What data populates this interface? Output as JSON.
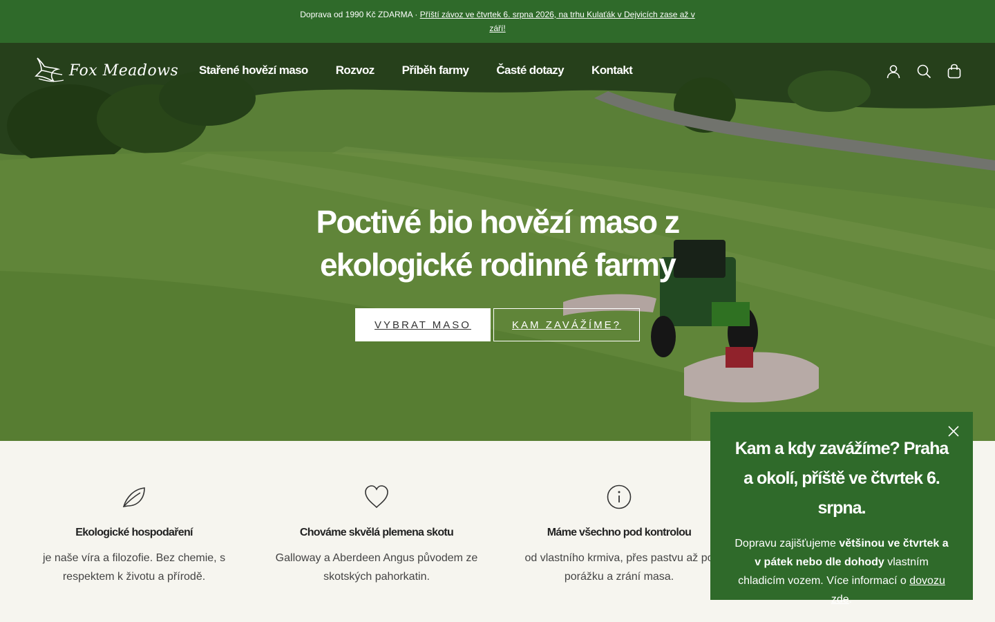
{
  "announcement": {
    "text": "Doprava od 1990 Kč ZDARMA",
    "separator": "·",
    "link": "Příští závoz ve čtvrtek 6. srpna 2026, na trhu Kulaťák v Dejvicích zase až v září!"
  },
  "header": {
    "logo_text": "Fox Meadows",
    "nav": [
      "Stařené hovězí maso",
      "Rozvoz",
      "Příběh farmy",
      "Časté dotazy",
      "Kontakt"
    ],
    "icons": [
      "account-icon",
      "search-icon",
      "cart-icon"
    ]
  },
  "hero": {
    "title": "Poctivé bio hovězí maso z ekologické rodinné farmy",
    "primary_button": "VYBRAT MASO",
    "secondary_button": "KAM ZAVÁŽÍME?"
  },
  "features": [
    {
      "icon": "leaf-icon",
      "title": "Ekologické hospodaření",
      "text": "je naše víra a filozofie. Bez chemie, s respektem k životu a přírodě."
    },
    {
      "icon": "heart-icon",
      "title": "Chováme skvělá plemena skotu",
      "text": "Galloway a Aberdeen Angus původem ze skotských pahorkatin."
    },
    {
      "icon": "info-icon",
      "title": "Máme všechno pod kontrolou",
      "text": "od vlastního krmiva, přes pastvu až po porážku a zrání masa."
    }
  ],
  "popup": {
    "title": "Kam a kdy zavážíme? Praha a okolí, příště ve čtvrtek 6. srpna.",
    "body_prefix": "Dopravu zajišťujeme ",
    "body_bold": "většinou ve čtvrtek a v pátek nebo dle dohody",
    "body_middle": " vlastním chladicím vozem. Více informací o ",
    "body_link": "dovozu zde",
    "body_suffix": "."
  },
  "colors": {
    "brand_green": "#2f6a2a",
    "background": "#f6f5ef"
  }
}
